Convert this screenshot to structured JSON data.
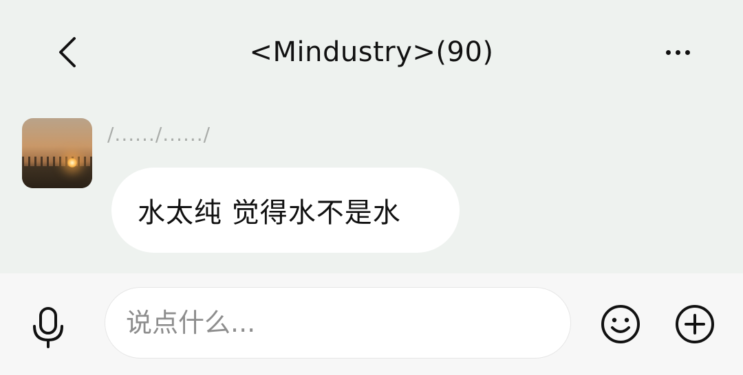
{
  "header": {
    "title": "<Mindustry>(90)",
    "back_icon": "chevron-left-icon",
    "more_icon": "more-horizontal-icon"
  },
  "messages": [
    {
      "sender_name": "/....../....../",
      "text": "水太纯 觉得水不是水",
      "avatar_icon": "sunset-avatar"
    }
  ],
  "input_bar": {
    "placeholder": "说点什么...",
    "value": "",
    "mic_icon": "microphone-icon",
    "emoji_icon": "smiley-icon",
    "plus_icon": "plus-circle-icon"
  },
  "colors": {
    "background": "#eef2ef",
    "bubble": "#ffffff",
    "input_bar": "#f7f7f7",
    "text": "#111111",
    "sender_name": "#a9aca9",
    "placeholder": "#8d8d8d"
  }
}
